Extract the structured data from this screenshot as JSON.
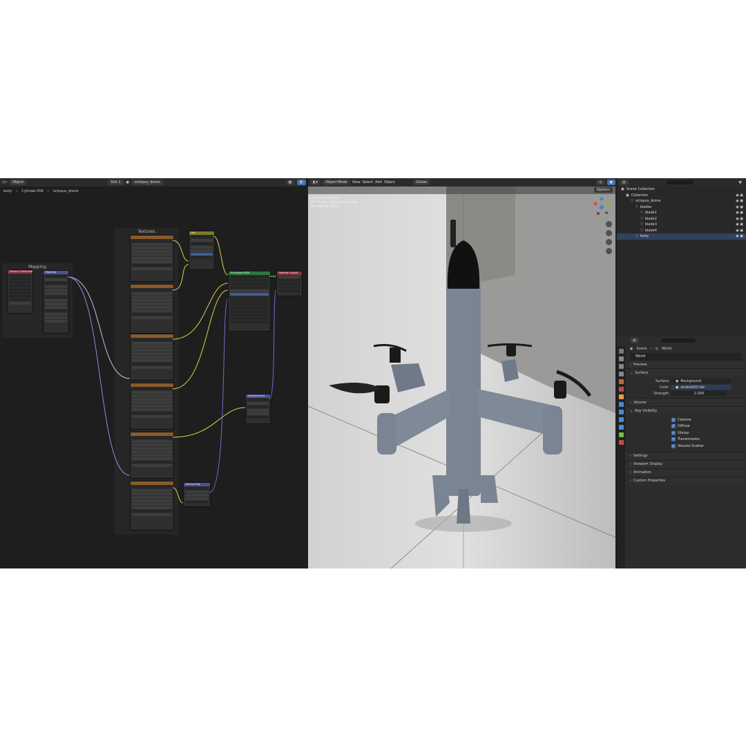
{
  "node_editor": {
    "header": {
      "editor_type": "Object",
      "slot": "Slot 1",
      "material": "octopus_drone"
    },
    "breadcrumb": [
      "body",
      "Cylinder.058",
      "octopus_drone"
    ],
    "frames": {
      "mapping_title": "Mapping",
      "textures_title": "Textures"
    },
    "nodes": {
      "tex_coord": "Texture Coordinate",
      "mapping": "Mapping",
      "mix": "Mix",
      "principled": "Principled BSDF",
      "material_output": "Material Output",
      "displacement": "Displacement",
      "normal_map": "Normal Map"
    }
  },
  "viewport": {
    "header": {
      "mode": "Object Mode",
      "menus": [
        "View",
        "Select",
        "Add",
        "Object"
      ],
      "orientation": "Global"
    },
    "options_label": "Options",
    "info_lines": [
      "User Perspective",
      "(0) Scene Collection | body",
      "Rendering Done"
    ]
  },
  "outliner": {
    "rows": [
      {
        "label": "Scene Collection",
        "indent": 0
      },
      {
        "label": "Collection",
        "indent": 1
      },
      {
        "label": "octopus_drone",
        "indent": 2
      },
      {
        "label": "blades",
        "indent": 3
      },
      {
        "label": "blade1",
        "indent": 4
      },
      {
        "label": "blade2",
        "indent": 4
      },
      {
        "label": "blade3",
        "indent": 4
      },
      {
        "label": "blade4",
        "indent": 4
      },
      {
        "label": "body",
        "indent": 3
      }
    ]
  },
  "properties": {
    "breadcrumb": {
      "scene": "Scene",
      "world": "World"
    },
    "world_name": "World",
    "panels": {
      "preview": "Preview",
      "surface": "Surface",
      "volume": "Volume",
      "ray_visibility": "Ray Visibility",
      "settings": "Settings",
      "viewport_display": "Viewport Display",
      "animation": "Animation",
      "custom_properties": "Custom Properties"
    },
    "surface": {
      "surface_label": "Surface",
      "surface_value": "Background",
      "color_label": "Color",
      "color_value": "studio020.hdr",
      "strength_label": "Strength",
      "strength_value": "2.000"
    },
    "ray_visibility": [
      "Camera",
      "Diffuse",
      "Glossy",
      "Transmission",
      "Volume Scatter"
    ]
  }
}
